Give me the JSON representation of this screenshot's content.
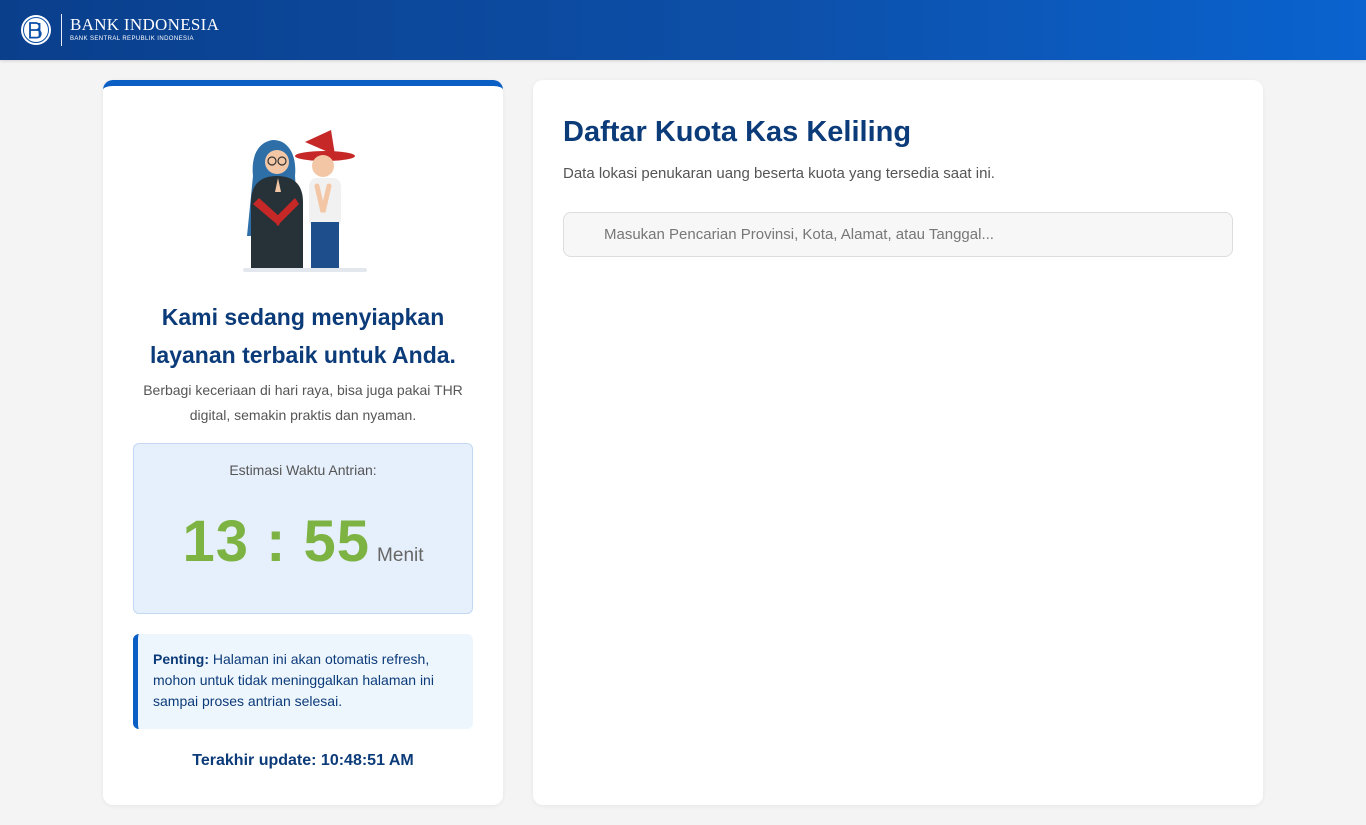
{
  "header": {
    "logo_title": "BANK INDONESIA",
    "logo_subtitle": "BANK SENTRAL REPUBLIK INDONESIA",
    "brand_color": "#0a4fa8"
  },
  "left_panel": {
    "headline": "Kami sedang menyiapkan layanan terbaik untuk Anda.",
    "subtext": "Berbagi keceriaan di hari raya, bisa juga pakai THR digital, semakin praktis dan nyaman.",
    "timer": {
      "label": "Estimasi Waktu Antrian:",
      "value": "13 : 55",
      "unit": "Menit",
      "color": "#7cb342"
    },
    "notice": {
      "bold": "Penting:",
      "text": "Halaman ini akan otomatis refresh, mohon untuk tidak meninggalkan halaman ini sampai proses antrian selesai."
    },
    "last_update": "Terakhir update: 10:48:51 AM"
  },
  "right_panel": {
    "title": "Daftar Kuota Kas Keliling",
    "subtitle": "Data lokasi penukaran uang beserta kuota yang tersedia saat ini.",
    "search": {
      "placeholder": "Masukan Pencarian Provinsi, Kota, Alamat, atau Tanggal...",
      "value": ""
    }
  }
}
